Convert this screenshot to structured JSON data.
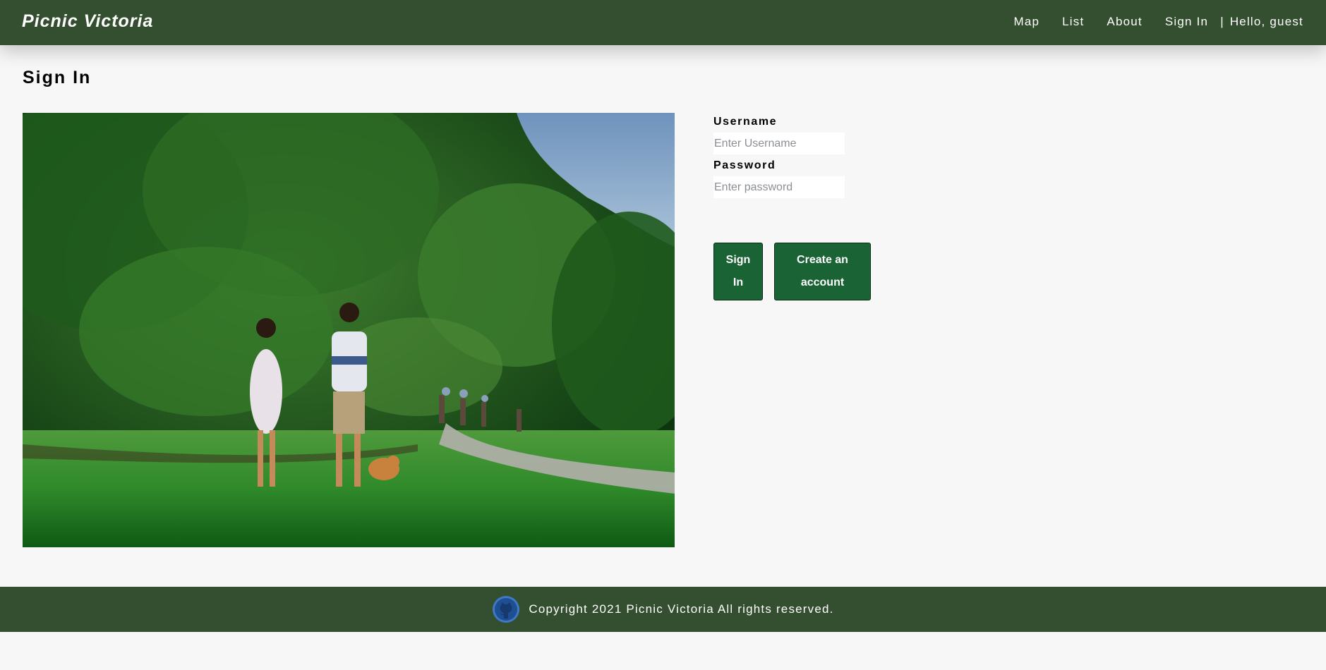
{
  "header": {
    "brand": "Picnic Victoria",
    "nav": [
      {
        "label": "Map"
      },
      {
        "label": "List"
      },
      {
        "label": "About"
      },
      {
        "label": "Sign In"
      }
    ],
    "separator": "|",
    "greeting": "Hello, guest"
  },
  "page": {
    "title": "Sign In"
  },
  "hero_image": {
    "description": "couple-walking-dog-in-park-photo"
  },
  "form": {
    "username_label": "Username",
    "username_placeholder": "Enter Username",
    "password_label": "Password",
    "password_placeholder": "Enter password",
    "signin_button": "Sign In",
    "create_button": "Create an account"
  },
  "footer": {
    "icon": "github-icon",
    "copyright": "Copyright 2021 Picnic Victoria All rights reserved."
  },
  "colors": {
    "navbar": "#344f2f",
    "button": "#1a6334",
    "background": "#f7f7f7"
  }
}
